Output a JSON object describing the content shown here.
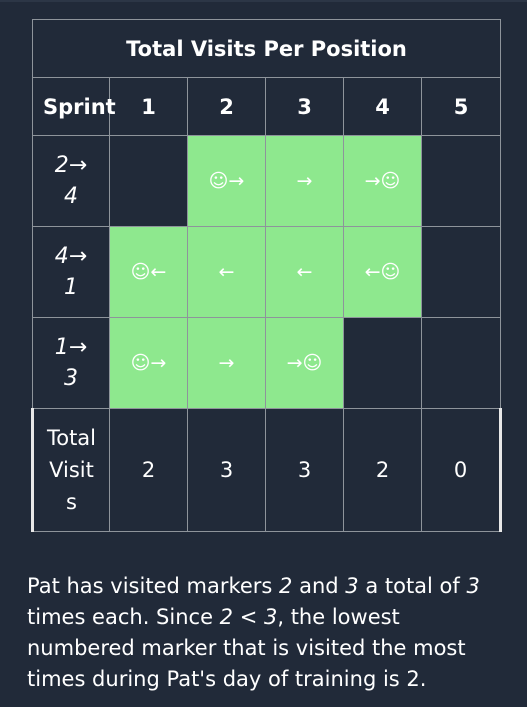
{
  "table": {
    "title": "Total Visits Per Position",
    "sprint_header": "Sprint",
    "positions": [
      "1",
      "2",
      "3",
      "4",
      "5"
    ],
    "sprints": [
      {
        "label_top": "2→",
        "label_bottom": "4",
        "cells": [
          {
            "text": "",
            "visited": false
          },
          {
            "text": "☺→",
            "visited": true
          },
          {
            "text": "→",
            "visited": true
          },
          {
            "text": "→☺",
            "visited": true
          },
          {
            "text": "",
            "visited": false
          }
        ]
      },
      {
        "label_top": "4→",
        "label_bottom": "1",
        "cells": [
          {
            "text": "☺←",
            "visited": true
          },
          {
            "text": "←",
            "visited": true
          },
          {
            "text": "←",
            "visited": true
          },
          {
            "text": "←☺",
            "visited": true
          },
          {
            "text": "",
            "visited": false
          }
        ]
      },
      {
        "label_top": "1→",
        "label_bottom": "3",
        "cells": [
          {
            "text": "☺→",
            "visited": true
          },
          {
            "text": "→",
            "visited": true
          },
          {
            "text": "→☺",
            "visited": true
          },
          {
            "text": "",
            "visited": false
          },
          {
            "text": "",
            "visited": false
          }
        ]
      }
    ],
    "total_label_lines": [
      "Total",
      "Visit",
      "s"
    ],
    "totals": [
      "2",
      "3",
      "3",
      "2",
      "0"
    ]
  },
  "explanation": {
    "p1": "Pat has visited markers ",
    "m1": "2",
    "p2": " and ",
    "m2": "3",
    "p3": " a total of ",
    "m3": "3",
    "p4": " times each.  Since ",
    "m4": "2 < 3",
    "p5": ", the lowest numbered marker that is visited the most times during Pat's day of training is 2."
  },
  "colors": {
    "background": "#212a39",
    "visited_cell": "#8ee88e",
    "grid_line": "#8e949b",
    "totals_border": "#e8e8e8"
  }
}
